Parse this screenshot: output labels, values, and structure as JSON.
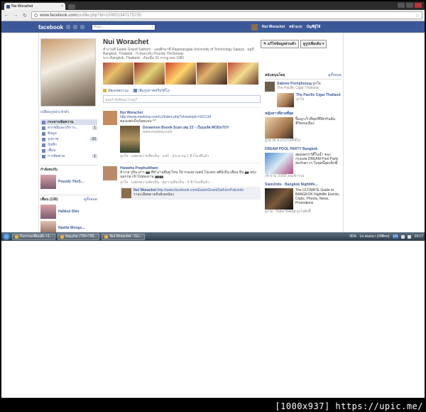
{
  "browser": {
    "tab_title": "Nui Worachet",
    "tab_close": "×",
    "url_prefix": "www.facebook.com",
    "url_path": "/profile.php?id=100001347175735",
    "back": "←",
    "forward": "→",
    "refresh": "↻",
    "star": "☆"
  },
  "fb": {
    "logo": "facebook",
    "search_placeholder": "ค้นหา",
    "user_name": "Nui Worachet",
    "nav_home": "หน้าแรก",
    "nav_account": "บัญชีผู้ใช้"
  },
  "profile": {
    "name": "Nui Worachet",
    "info_line1": "ทำงานที่ Eastin Grand Sathorn · เคยศึกษาที่ Rajamangala University of Technology Sataya · อยู่ที่ Bangkok, Thailand · กำลังคบกับ Poundz TheSmeay",
    "info_line2": "จาก Bangkok, Thailand · เกิดเมื่อ 31 กรกฎาคม 1981",
    "edit_picture": "เปลี่ยนรูปประจำตัว",
    "edit_profile_button": "✎ แก้ไขข้อมูลส่วนตัว",
    "photos_button": "ดูรูปเพิ่มเติม ▾"
  },
  "left_menu": {
    "items": [
      {
        "label": "กระดานข้อความ",
        "active": true,
        "count": ""
      },
      {
        "label": "ดรรชนีและบริการ...",
        "active": false,
        "count": "1"
      },
      {
        "label": "ข้อมูล",
        "active": false,
        "count": ""
      },
      {
        "label": "รูปภาพ",
        "active": false,
        "count": "93"
      },
      {
        "label": "บันทึก",
        "active": false,
        "count": ""
      },
      {
        "label": "เพื่อน",
        "active": false,
        "count": ""
      },
      {
        "label": "การติดตาม",
        "active": false,
        "count": "1"
      }
    ],
    "relationship_title": "กำลังคบกับ",
    "relationship_name": "Poundz TheS...",
    "friends_title": "เพื่อน (138)",
    "friends_more": "ดูทั้งหมด",
    "friends": [
      "HaNeul Shin",
      "Nadda Wongs..."
    ]
  },
  "wall": {
    "publisher_status": "อัพเดทสถานะ",
    "publisher_photo": "เพิ่มรูปภาพหรือวิดีโอ",
    "composer_placeholder": "คุณกำลังคิดอะไรอยู่?",
    "story1": {
      "author": "Nui Worachet",
      "link": "http://www.modxtoy.com/v1/index.php?showtopic=162134",
      "text": "ของแพร่เป็นร้อยแบบ ^^",
      "attach_title": "Doraemon Boook Scan เล่ม 23 - เว็บบอร์ด MODxTOY",
      "attach_source": "www.modxtoy.com",
      "meta": "ถูกใจ · แสดงความคิดเห็น · แชร์ · ประมาณ 1 ชั่วโมงที่แล้ว"
    },
    "story2": {
      "author": "Hwawha Praphudtham",
      "text": "ห้ บาย รูปิน ม่าว 📷 ที่ทำงานที่อยู่ ไหน ใช่ กรองยานพน์ ไปเลยๆ สตีบ์เป็น เดือน มีบ 📷 พรุ่งนอกกล่ เข้าไปส่องงาน 📷📷",
      "meta": "ถูกใจ · แสดงความคิดเห็น · ดูความคิดเห็น · 4 ชั่วโมงที่แล้ว ·",
      "comment_author": "Nui Worachet",
      "comment_link": "http://www.facebook.com/EastinGrandSathornPakvinfo",
      "comment_text": "ราละเอียดตามลิงค์เลยน้อง"
    }
  },
  "sidebar": {
    "title": "สนับสนุนโดย",
    "more": "ดูทั้งหมด",
    "liked_user": "Sabnee Pornphoung",
    "liked_verb": "ถูกใจ",
    "liked_page": "The Pacific Cigar Thailand",
    "ad1_title": "The Pacific Cigar Thailand",
    "ad1_like": "ถูกใจ",
    "ad2_title": "หญิงสาวที่สวยที่สุด",
    "ad2_text": "ปิ้มญาเร็วที่สุดที่ปีหักกินลีน ชีวิตคนเมือง",
    "ad2_meta": "ผู้ใช้ 3b พวกไปได้ที่นี่ไป",
    "ad3_title": "DREAM POOL PARTY Bangkok",
    "ad3_text": "สุดยอดปาร์ตี้ในน้ำ ของกรุงเทพ DREAM Pool Party พบกับสาวๆ ในชุดนี้สุดเซ็กซี่",
    "ad3_meta": "เข้าร่วม 3,692 คนเข้าร่วม",
    "ad4_title": "Siam2nite - Bangkok Nightlife...",
    "ad4_text": "The ULTIMATE Guide to BANGKOK Nightlife Events, Clubs, Photos, News, Promotions",
    "ad4_meta": "ถูกใจ · Nake Nakejt ถูกใจสิ่งนี้"
  },
  "taskbar": {
    "items": [
      "กิจกรรมเพื่อนสั่ง +1...",
      "img.php (755×700...",
      "Nui Worachet - Go..."
    ],
    "zoom": "95%",
    "chat": "1ส สนทนา (Offline)",
    "lang": "EN",
    "clock": "19:17"
  },
  "credit": "[1000x937] https://upic.me/"
}
